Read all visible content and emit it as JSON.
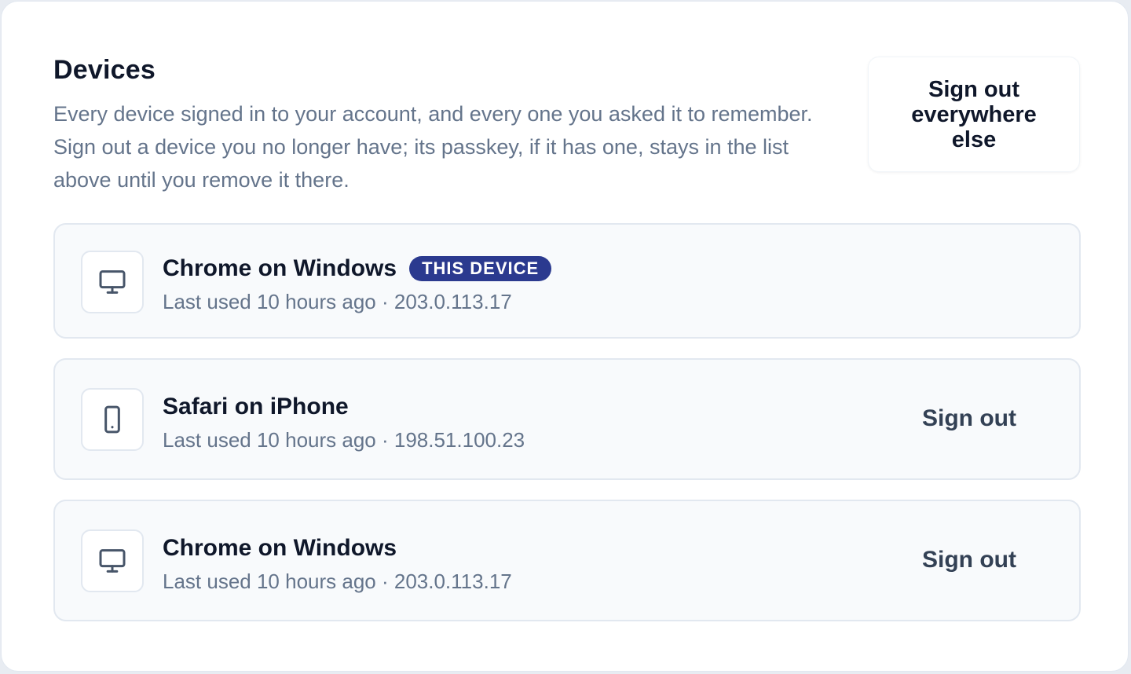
{
  "section": {
    "title": "Devices",
    "description": "Every device signed in to your account, and every one you asked it to remember. Sign out a device you no longer have; its passkey, if it has one, stays in the list above until you remove it there.",
    "sign_out_all_label": "Sign out everywhere else"
  },
  "devices": [
    {
      "name": "Chrome on Windows",
      "icon": "monitor-icon",
      "badge": "THIS DEVICE",
      "meta": "Last used 10 hours ago · 203.0.113.17",
      "action": ""
    },
    {
      "name": "Safari on iPhone",
      "icon": "phone-icon",
      "badge": "",
      "meta": "Last used 10 hours ago · 198.51.100.23",
      "action": "Sign out"
    },
    {
      "name": "Chrome on Windows",
      "icon": "monitor-icon",
      "badge": "",
      "meta": "Last used 10 hours ago · 203.0.113.17",
      "action": "Sign out"
    }
  ],
  "colors": {
    "badge_bg": "#2b3a8f",
    "title": "#0f172a",
    "muted": "#64748b",
    "row_bg": "#f8fafc",
    "border": "#e2e8f0"
  }
}
